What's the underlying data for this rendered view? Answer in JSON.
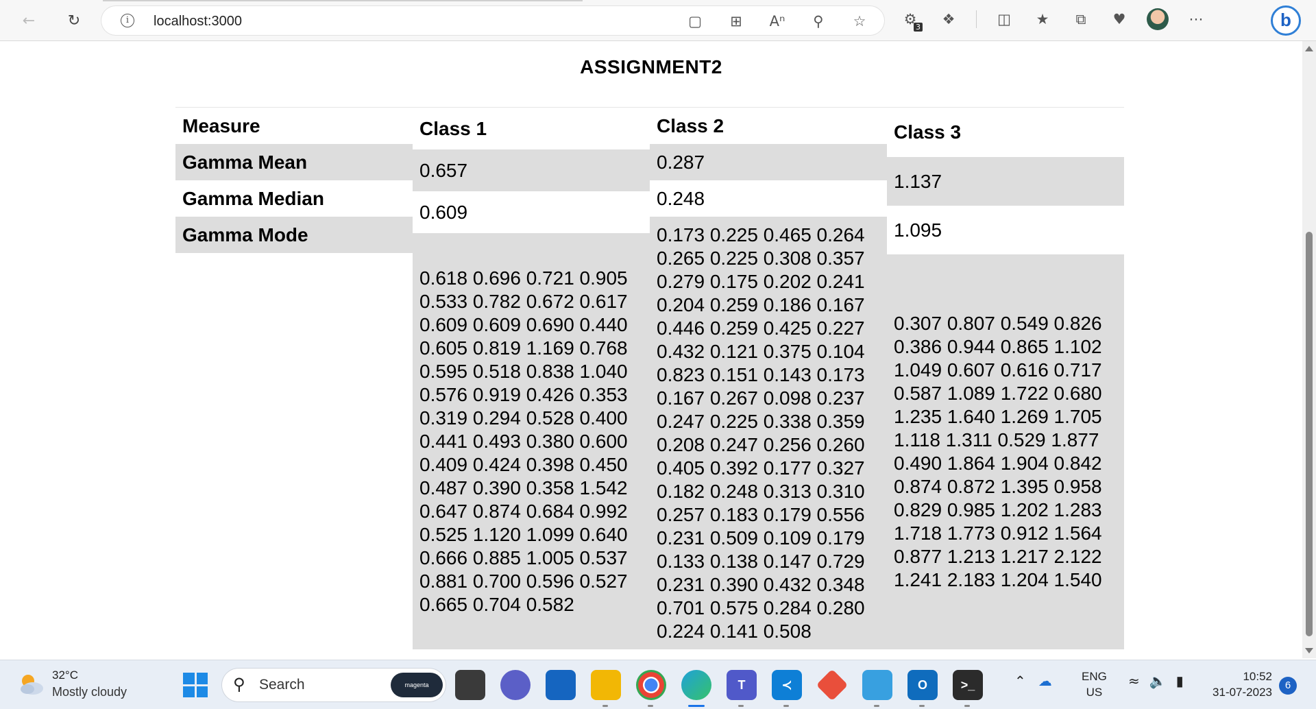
{
  "browser": {
    "url": "localhost:3000",
    "extensions_badge": "3"
  },
  "page": {
    "title": "ASSIGNMENT2"
  },
  "measure_column": {
    "header": "Measure",
    "rows": [
      "Gamma Mean",
      "Gamma Median",
      "Gamma Mode"
    ]
  },
  "classes": [
    {
      "header": "Class 1",
      "mean": "0.657",
      "median": "0.609",
      "mode": "0.618 0.696 0.721 0.905 0.533 0.782 0.672 0.617 0.609 0.609 0.690 0.440 0.605 0.819 1.169 0.768 0.595 0.518 0.838 1.040 0.576 0.919 0.426 0.353 0.319 0.294 0.528 0.400 0.441 0.493 0.380 0.600 0.409 0.424 0.398 0.450 0.487 0.390 0.358 1.542 0.647 0.874 0.684 0.992 0.525 1.120 1.099 0.640 0.666 0.885 1.005 0.537 0.881 0.700 0.596 0.527 0.665 0.704 0.582"
    },
    {
      "header": "Class 2",
      "mean": "0.287",
      "median": "0.248",
      "mode": "0.173 0.225 0.465 0.264 0.265 0.225 0.308 0.357 0.279 0.175 0.202 0.241 0.204 0.259 0.186 0.167 0.446 0.259 0.425 0.227 0.432 0.121 0.375 0.104 0.823 0.151 0.143 0.173 0.167 0.267 0.098 0.237 0.247 0.225 0.338 0.359 0.208 0.247 0.256 0.260 0.405 0.392 0.177 0.327 0.182 0.248 0.313 0.310 0.257 0.183 0.179 0.556 0.231 0.509 0.109 0.179 0.133 0.138 0.147 0.729 0.231 0.390 0.432 0.348 0.701 0.575 0.284 0.280 0.224 0.141 0.508"
    },
    {
      "header": "Class 3",
      "mean": "1.137",
      "median": "1.095",
      "mode": "0.307 0.807 0.549 0.826 0.386 0.944 0.865 1.102 1.049 0.607 0.616 0.717 0.587 1.089 1.722 0.680 1.235 1.640 1.269 1.705 1.118 1.311 0.529 1.877 0.490 1.864 1.904 0.842 0.874 0.872 1.395 0.958 0.829 0.985 1.202 1.283 1.718 1.773 0.912 1.564 0.877 1.213 1.217 2.122 1.241 2.183 1.204 1.540"
    }
  ],
  "taskbar": {
    "weather_temp": "32°C",
    "weather_desc": "Mostly cloudy",
    "search_placeholder": "Search",
    "search_pill": "magenta",
    "lang_top": "ENG",
    "lang_bottom": "US",
    "time": "10:52",
    "date": "31-07-2023",
    "notifications": "6"
  },
  "colors": {
    "row_grey": "#dddddd",
    "accent": "#1a73e8"
  }
}
